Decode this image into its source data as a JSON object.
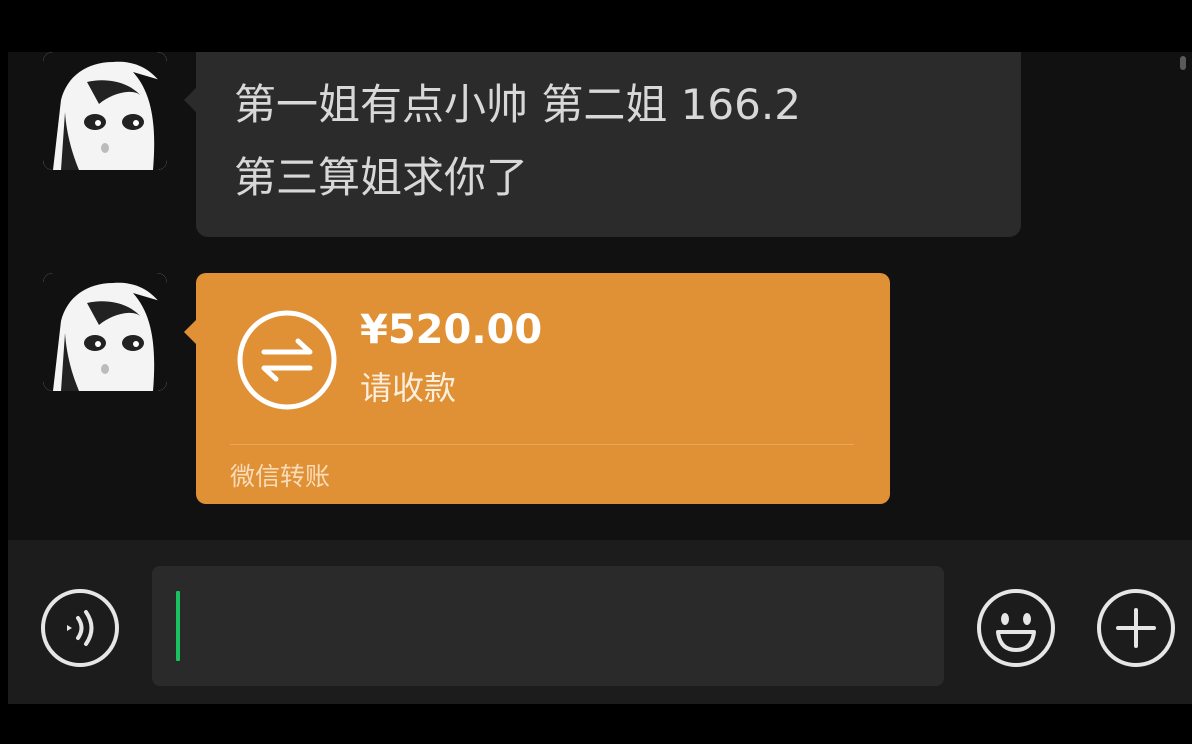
{
  "messages": [
    {
      "type": "text",
      "lines": [
        "第一姐有点小帅 第二姐 166.2",
        "第三算姐求你了"
      ]
    },
    {
      "type": "transfer",
      "amount": "¥520.00",
      "status": "请收款",
      "source": "微信转账"
    }
  ],
  "input": {
    "value": "",
    "voice_icon": "voice-icon",
    "emoji_icon": "emoji-icon",
    "plus_icon": "plus-icon"
  },
  "colors": {
    "transfer_bubble": "#e09035",
    "text_bubble": "#2b2b2b",
    "caret": "#19c25e",
    "background": "#111111"
  }
}
